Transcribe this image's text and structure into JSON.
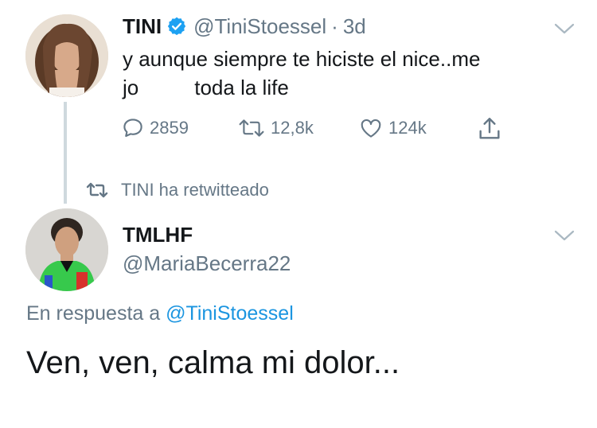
{
  "tweet1": {
    "author_name": "TINI",
    "verified": true,
    "handle": "@TiniStoessel",
    "separator": "·",
    "time": "3d",
    "text_line1": "y aunque siempre te hiciste el nice..me",
    "text_line2_start": "jo",
    "text_line2_end": "toda la life",
    "actions": {
      "replies": "2859",
      "retweets": "12,8k",
      "likes": "124k"
    }
  },
  "retweet_context": "TINI ha retwitteado",
  "tweet2": {
    "author_name": "TMLHF",
    "handle": "@MariaBecerra22",
    "reply_prefix": "En respuesta a",
    "reply_mention": "@TiniStoessel",
    "text": "Ven, ven, calma mi dolor..."
  },
  "colors": {
    "accent": "#1da1f2",
    "muted": "#657786",
    "text": "#14171a",
    "mention": "#1b95e0"
  },
  "icons": [
    "reply-icon",
    "retweet-icon",
    "like-icon",
    "share-icon",
    "chevron-down-icon",
    "verified-badge-icon"
  ]
}
